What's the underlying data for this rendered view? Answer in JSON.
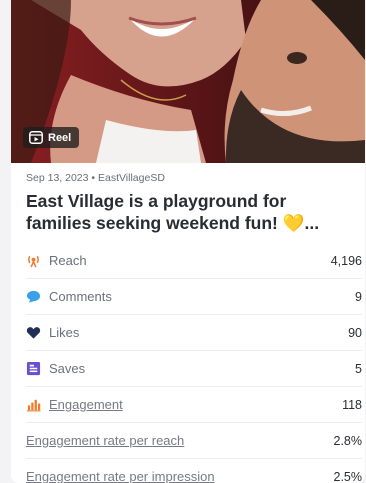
{
  "post": {
    "badge_label": "Reel",
    "date_account": "Sep 13, 2023 • EastVillageSD",
    "title": "East Village is a playground for families seeking weekend fun! 💛..."
  },
  "metrics": [
    {
      "icon": "broadcast-icon",
      "label": "Reach",
      "value": "4,196",
      "color": "#f07a2a"
    },
    {
      "icon": "comment-bubble-icon",
      "label": "Comments",
      "value": "9",
      "color": "#3aa0ea"
    },
    {
      "icon": "heart-icon",
      "label": "Likes",
      "value": "90",
      "color": "#1f2f55"
    },
    {
      "icon": "bookmark-list-icon",
      "label": "Saves",
      "value": "5",
      "color": "#6b4fd3"
    },
    {
      "icon": "bar-chart-icon",
      "label": "Engagement",
      "value": "118",
      "color": "#f07a2a"
    },
    {
      "label": "Engagement rate per reach",
      "value": "2.8%"
    },
    {
      "label": "Engagement rate per impression",
      "value": "2.5%"
    }
  ]
}
